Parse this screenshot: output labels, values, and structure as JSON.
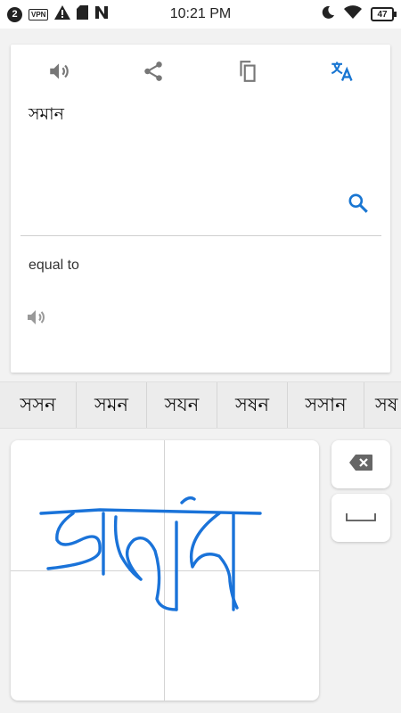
{
  "status_bar": {
    "notification_count": "2",
    "vpn_label": "VPN",
    "time": "10:21 PM",
    "battery": "47",
    "icons": [
      "notification-count-icon",
      "vpn-icon",
      "warning-icon",
      "sd-card-icon",
      "n-app-icon",
      "moon-icon",
      "wifi-icon",
      "battery-icon"
    ]
  },
  "toolbar": {
    "icons": [
      "speaker-icon",
      "share-icon",
      "copy-icon",
      "translate-icon"
    ],
    "accent_color": "#1976d2"
  },
  "source": {
    "text": "সমান"
  },
  "result": {
    "translation": "equal to"
  },
  "suggestions": [
    "সসন",
    "সমন",
    "সযন",
    "সষন",
    "সসান",
    "সষ"
  ],
  "handwriting": {
    "ink_color": "#1a73d9"
  },
  "keys": {
    "icons": [
      "backspace-icon",
      "space-icon"
    ]
  }
}
